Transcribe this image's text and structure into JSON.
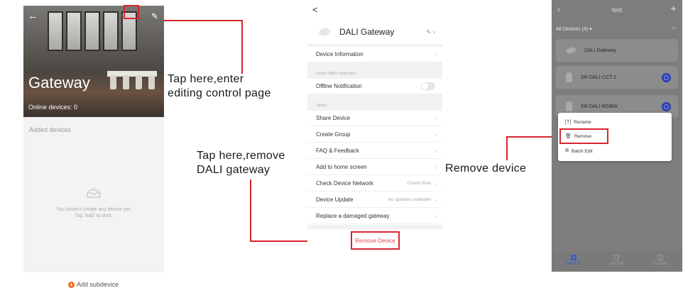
{
  "screen1": {
    "title": "Gateway",
    "online_devices": "Online devices: 0",
    "added_devices": "Added devices",
    "empty_line1": "You haven't create any device yet.",
    "empty_line2": "Tap 'Add' to start.",
    "add_subdevice": "Add subdevice",
    "back_icon": "back-arrow-icon",
    "edit_icon": "pencil-icon"
  },
  "annotations": {
    "edit_line1": "Tap here,enter",
    "edit_line2": "editing control page",
    "remove_line1": "Tap here,remove",
    "remove_line2": "DALI gateway",
    "remove_device": "Remove device",
    "highlight_color": "#d6262c"
  },
  "screen2": {
    "back": "<",
    "device_name": "DALI Gateway",
    "rows": {
      "device_information": "Device Information",
      "offline_section": "Device Offline Notification",
      "offline_notification": "Offline Notification",
      "others_section": "Others",
      "share_device": "Share Device",
      "create_group": "Create Group",
      "faq": "FAQ & Feedback",
      "add_home": "Add to home screen",
      "check_network": "Check Device Network",
      "check_now": "Check Now",
      "device_update": "Device Update",
      "no_updates": "No updates available",
      "replace_gateway": "Replace a damaged gateway"
    },
    "remove_device": "Remove Device"
  },
  "screen3": {
    "title": "test",
    "filter": "All Devices (4)",
    "devices": [
      "DALI Gateway",
      "SR-DALI-CCT 2",
      "SR-DALI-RGBW"
    ],
    "menu": {
      "rename": "Rename",
      "remove": "Remove",
      "batch_edit": "Batch Edit"
    },
    "tabs": [
      "DEVICE",
      "GROUP",
      "SCENE"
    ],
    "accent": "#3654d6"
  }
}
